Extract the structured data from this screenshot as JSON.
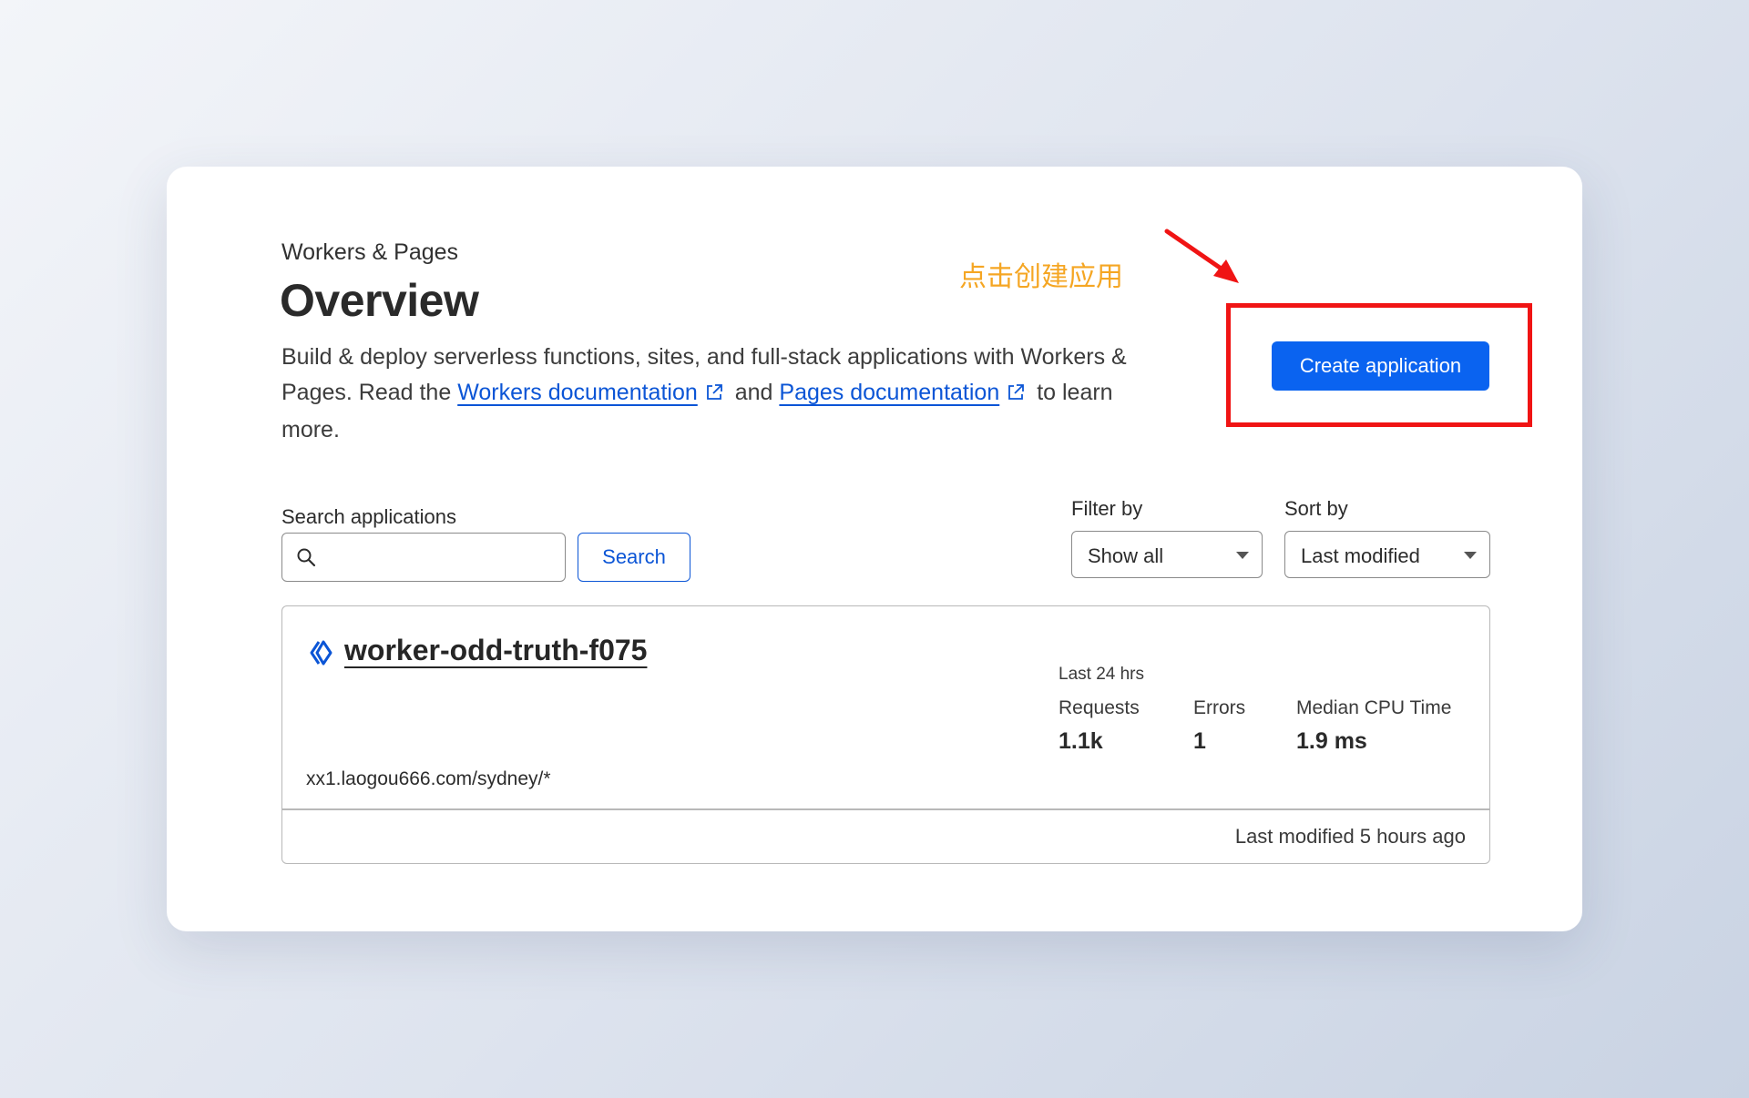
{
  "header": {
    "breadcrumb": "Workers & Pages",
    "title": "Overview",
    "description_part1": "Build & deploy serverless functions, sites, and full-stack applications with Workers & Pages. Read the",
    "workers_link": "Workers documentation",
    "description_and": "and",
    "pages_link": "Pages documentation",
    "description_end": "to learn more."
  },
  "annotation": {
    "text": "点击创建应用",
    "color": "#f5a623",
    "highlight_color": "#f01414"
  },
  "actions": {
    "create_label": "Create application",
    "accent": "#0a63f0"
  },
  "search": {
    "label": "Search applications",
    "value": "",
    "button_label": "Search",
    "icon": "search-icon"
  },
  "filter": {
    "label": "Filter by",
    "selected": "Show all"
  },
  "sort": {
    "label": "Sort by",
    "selected": "Last modified"
  },
  "applications": [
    {
      "name": "worker-odd-truth-f075",
      "icon": "worker-icon",
      "period": "Last 24 hrs",
      "metrics": [
        {
          "label": "Requests",
          "value": "1.1k"
        },
        {
          "label": "Errors",
          "value": "1"
        },
        {
          "label": "Median CPU Time",
          "value": "1.9 ms"
        }
      ],
      "route": "xx1.laogou666.com/sydney/*",
      "last_modified": "Last modified 5 hours ago"
    }
  ]
}
